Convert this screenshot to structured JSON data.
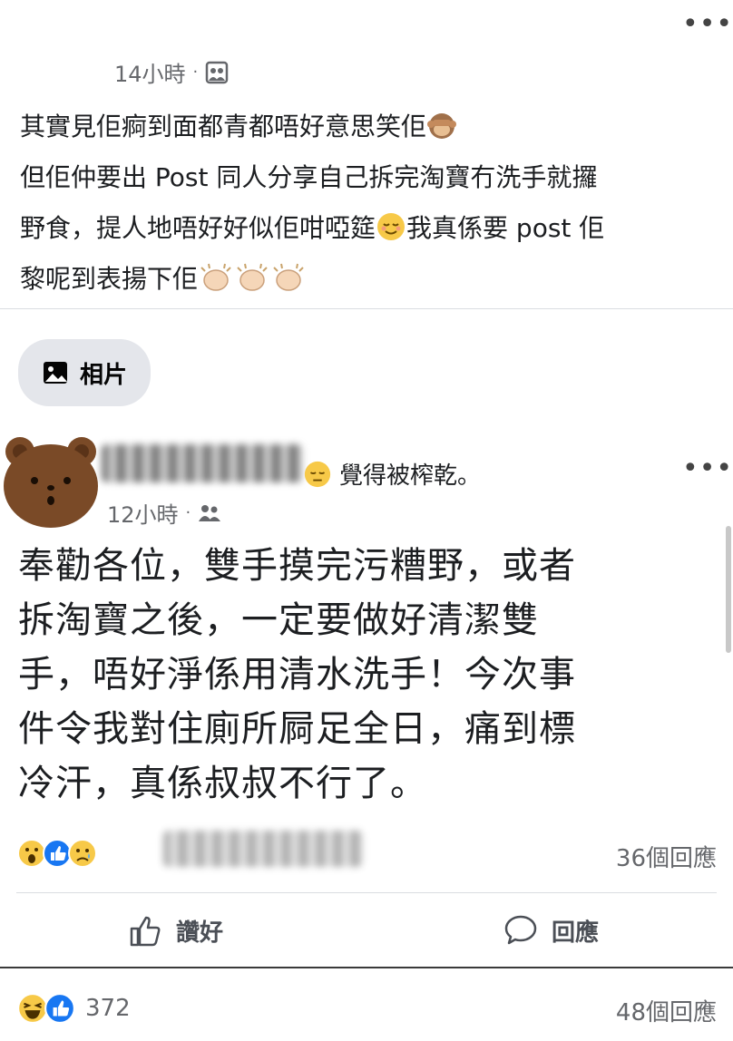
{
  "post": {
    "time": "14小時",
    "more": "•••",
    "lines": [
      "其實見佢痾到面都青都唔好意思笑佢",
      "但佢仲要出 Post 同人分享自己拆完淘寶冇洗手就攞",
      "野食，提人地唔好好似佢咁啞筵",
      "黎呢到表揚下佢"
    ],
    "line3_tail": "我真係要 post 佢",
    "photo_button": "相片"
  },
  "shared": {
    "feeling": "覺得被榨乾。",
    "time": "12小時",
    "more": "•••",
    "lines": [
      "奉勸各位，雙手摸完污糟野，或者",
      "拆淘寶之後，一定要做好清潔雙",
      "手，唔好淨係用清水洗手！今次事",
      "件令我對住廁所屙足全日，痛到標",
      "冷汗，真係叔叔不行了。"
    ],
    "comments": "36個回應",
    "like_label": "讚好",
    "comment_label": "回應"
  },
  "footer": {
    "reactions": "372",
    "comments": "48個回應"
  },
  "colors": {
    "meta": "#65676b",
    "like_blue": "#1877f2",
    "haha_yellow": "#f7c948",
    "bear_brown": "#7a4a27",
    "chip_bg": "#e4e6eb"
  }
}
